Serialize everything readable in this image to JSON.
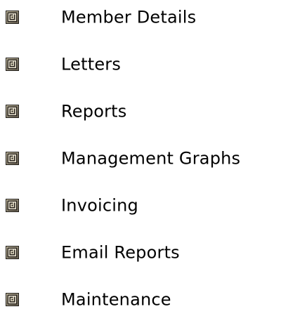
{
  "menu": {
    "items": [
      {
        "label": "Member Details",
        "icon": "spiral-bullet-icon"
      },
      {
        "label": "Letters",
        "icon": "spiral-bullet-icon"
      },
      {
        "label": "Reports",
        "icon": "spiral-bullet-icon"
      },
      {
        "label": "Management Graphs",
        "icon": "spiral-bullet-icon"
      },
      {
        "label": "Invoicing",
        "icon": "spiral-bullet-icon"
      },
      {
        "label": "Email Reports",
        "icon": "spiral-bullet-icon"
      },
      {
        "label": "Maintenance",
        "icon": "spiral-bullet-icon"
      }
    ]
  },
  "colors": {
    "background": "#ffffff",
    "text": "#000000",
    "icon_dark": "#2a2520",
    "icon_mid": "#8a8270",
    "icon_light": "#e8e2cf"
  }
}
